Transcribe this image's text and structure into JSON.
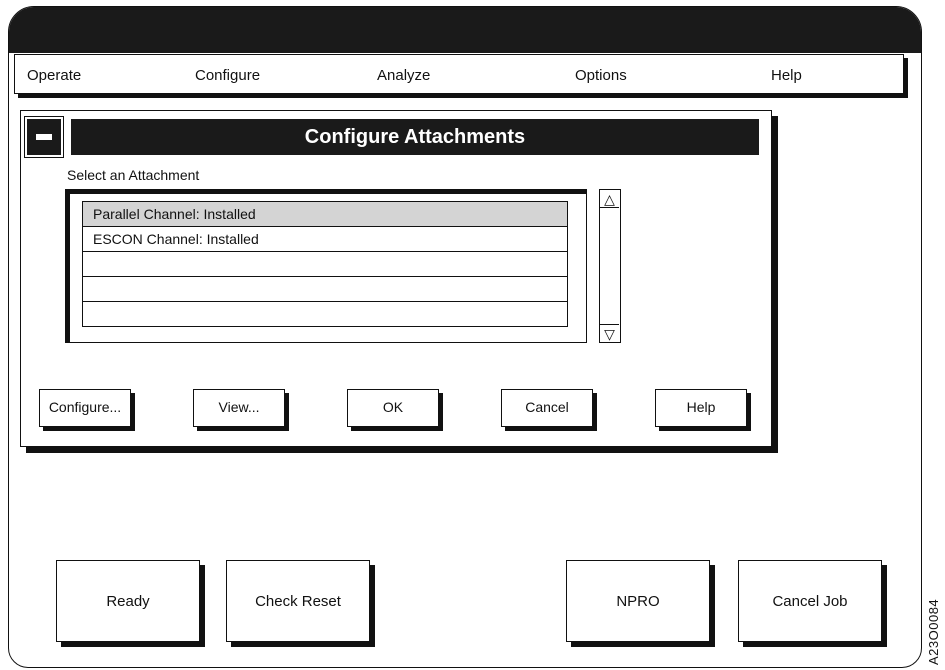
{
  "menu": {
    "items": [
      "Operate",
      "Configure",
      "Analyze",
      "Options",
      "Help"
    ]
  },
  "dialog": {
    "title": "Configure Attachments",
    "list_label": "Select an Attachment",
    "list_items": [
      "Parallel Channel: Installed",
      "ESCON Channel: Installed",
      "",
      "",
      ""
    ],
    "selected_index": 0,
    "scroll_up_icon": "triangle-up",
    "scroll_down_icon": "triangle-down",
    "buttons": {
      "configure": "Configure...",
      "view": "View...",
      "ok": "OK",
      "cancel": "Cancel",
      "help": "Help"
    }
  },
  "bottom_buttons": {
    "ready": "Ready",
    "check_reset": "Check Reset",
    "npro": "NPRO",
    "cancel_job": "Cancel Job"
  },
  "figure_code": "A23O0084"
}
